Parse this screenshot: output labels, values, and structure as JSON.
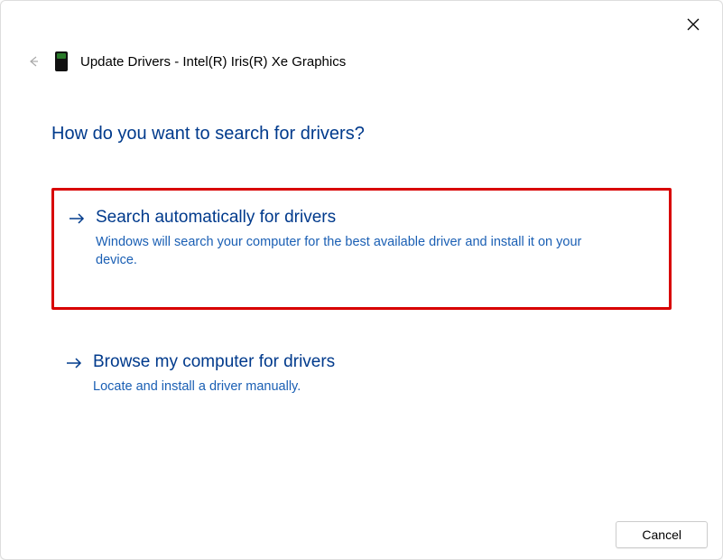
{
  "window": {
    "title": "Update Drivers - Intel(R) Iris(R) Xe Graphics"
  },
  "heading": "How do you want to search for drivers?",
  "options": {
    "auto": {
      "title": "Search automatically for drivers",
      "desc": "Windows will search your computer for the best available driver and install it on your device."
    },
    "browse": {
      "title": "Browse my computer for drivers",
      "desc": "Locate and install a driver manually."
    }
  },
  "buttons": {
    "cancel": "Cancel"
  }
}
